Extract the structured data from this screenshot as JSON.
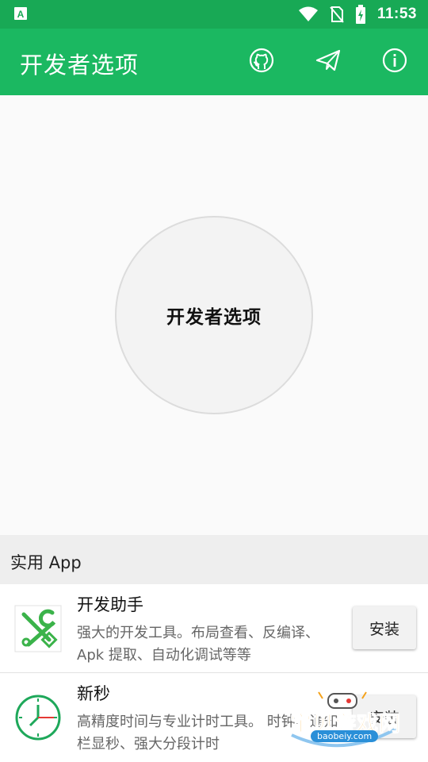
{
  "status_bar": {
    "time": "11:53",
    "left_icon": "app-a-icon",
    "icons": [
      "wifi-icon",
      "no-sim-icon",
      "battery-charging-icon"
    ]
  },
  "app_bar": {
    "title": "开发者选项",
    "actions": [
      "github-icon",
      "send-icon",
      "info-icon"
    ],
    "color": "#1bb861"
  },
  "main": {
    "circle_button_label": "开发者选项"
  },
  "section": {
    "title": "实用 App"
  },
  "apps": [
    {
      "name": "开发助手",
      "desc": "强大的开发工具。布局查看、反编译、Apk 提取、自动化调试等等",
      "install_label": "安装",
      "icon": "wrench-screwdriver-icon"
    },
    {
      "name": "新秒",
      "desc": "高精度时间与专业计时工具。 时钟、通知栏显秒、强大分段计时",
      "install_label": "安装",
      "icon": "clock-icon"
    }
  ],
  "watermark": {
    "text": "宝贝游戏网",
    "url": "baobeiy.com"
  }
}
